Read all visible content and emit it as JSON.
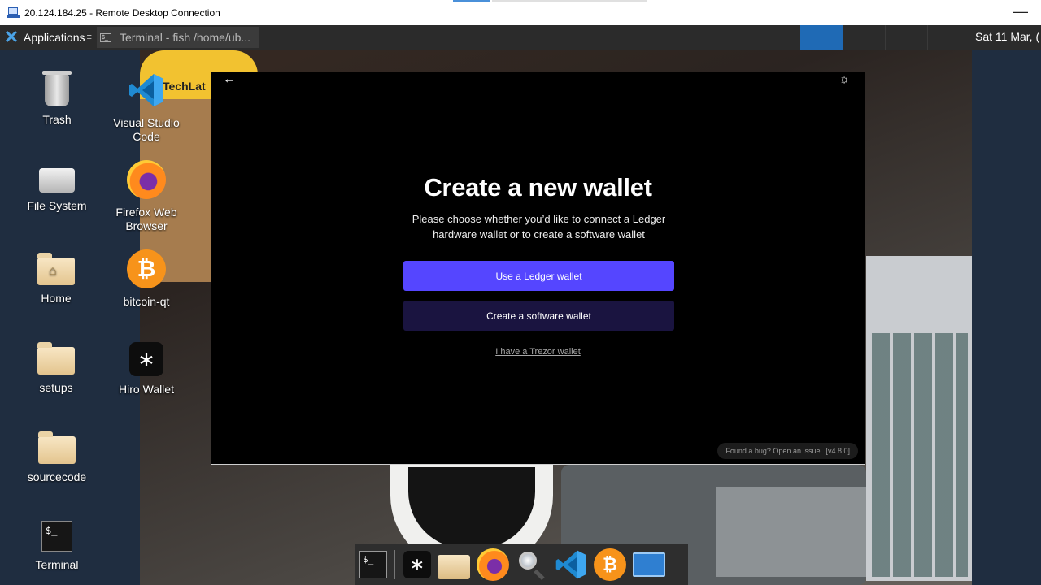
{
  "rdp": {
    "title": "20.124.184.25 - Remote Desktop Connection",
    "close_glyph": "—"
  },
  "panel": {
    "applications_label": "Applications",
    "applications_more": "≡",
    "task_title": "Terminal - fish /home/ub...",
    "task_icon_text": "$_",
    "clock": "Sat 11 Mar, ("
  },
  "desktop_icons": {
    "trash": "Trash",
    "vscode": "Visual Studio Code",
    "filesystem": "File System",
    "firefox": "Firefox Web Browser",
    "home": "Home",
    "bitcoin": "bitcoin-qt",
    "setups": "setups",
    "hiro": "Hiro Wallet",
    "sourcecode": "sourcecode",
    "terminal": "Terminal"
  },
  "icon_glyphs": {
    "hiro": "∗",
    "bitcoin": "₿",
    "terminal": "$_",
    "back_arrow": "←",
    "theme": "☼"
  },
  "wallpaper": {
    "logo_text": "TechLat"
  },
  "app": {
    "heading": "Create a new wallet",
    "subtext": "Please choose whether you’d like to connect a Ledger hardware wallet or to create a software wallet",
    "ledger_button": "Use a Ledger wallet",
    "software_button": "Create a software wallet",
    "trezor_link": "I have a Trezor wallet",
    "bug_link": "Found a bug? Open an issue",
    "version": "[v4.8.0]"
  },
  "colors": {
    "ledger_button": "#5546ff",
    "software_button": "#1a1440",
    "panel": "#2b2b2b",
    "workspace_active": "#1f6ab5"
  }
}
